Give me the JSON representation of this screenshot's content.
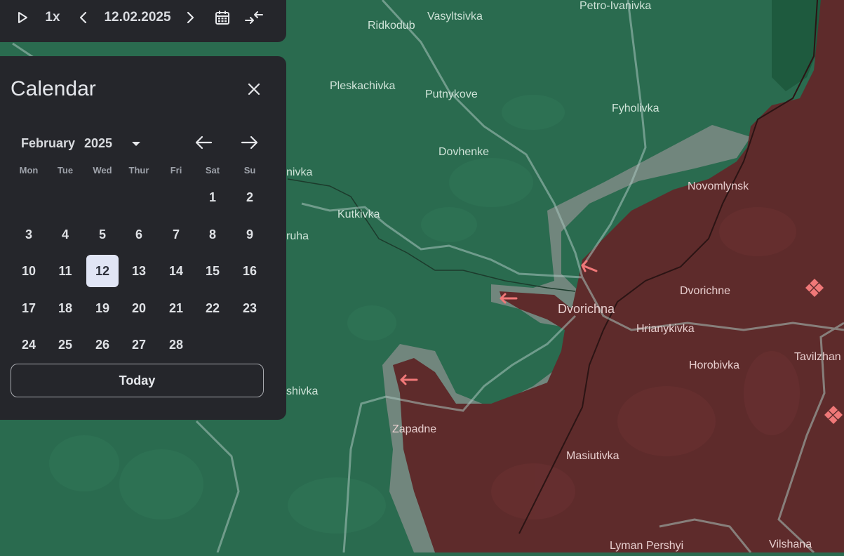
{
  "toolbar": {
    "play_icon": "play-icon",
    "speed": "1x",
    "prev_icon": "chevron-left-icon",
    "date": "12.02.2025",
    "next_icon": "chevron-right-icon",
    "calendar_icon": "calendar-icon",
    "collapse_icon": "collapse-arrows-icon"
  },
  "calendar": {
    "title": "Calendar",
    "close_icon": "close-icon",
    "month": "February",
    "year": "2025",
    "year_dropdown_icon": "caret-down-icon",
    "prev_month_icon": "arrow-left-icon",
    "next_month_icon": "arrow-right-icon",
    "weekdays": [
      "Mon",
      "Tue",
      "Wed",
      "Thur",
      "Fri",
      "Sat",
      "Su"
    ],
    "weeks": [
      [
        "",
        "",
        "",
        "",
        "",
        "1",
        "2"
      ],
      [
        "3",
        "4",
        "5",
        "6",
        "7",
        "8",
        "9"
      ],
      [
        "10",
        "11",
        "12",
        "13",
        "14",
        "15",
        "16"
      ],
      [
        "17",
        "18",
        "19",
        "20",
        "21",
        "22",
        "23"
      ],
      [
        "24",
        "25",
        "26",
        "27",
        "28",
        "",
        ""
      ]
    ],
    "selected_day": "12",
    "today_label": "Today"
  },
  "map": {
    "colors": {
      "controlled_green": "#2a6b4f",
      "occupied_red": "#5e2b2b",
      "contested_grey": "#8a8f8c",
      "attack_arrow": "#f07878",
      "road": "#a9c4be"
    },
    "places": {
      "petro_ivanivka": "Petro-Ivanivka",
      "vasyltsivka": "Vasyltsivka",
      "ridkodub": "Ridkodub",
      "pleskachivka": "Pleskachivka",
      "putnykove": "Putnykove",
      "fyholivka": "Fyholivka",
      "dovhenke": "Dovhenke",
      "ivka_partial": "nivka",
      "novomlynsk": "Novomlynsk",
      "kutkivka": "Kutkivka",
      "ruha_partial": "ruha",
      "dvorichne": "Dvorichne",
      "dvorichna": "Dvorichna",
      "hrianykivka": "Hrianykivka",
      "horobivka": "Horobivka",
      "tavilzhan": "Tavilzhan",
      "shivka_partial": "shivka",
      "zapadne": "Zapadne",
      "masiutivka": "Masiutivka",
      "lyman_pershyi": "Lyman Pershyi",
      "vilshana": "Vilshana"
    }
  }
}
